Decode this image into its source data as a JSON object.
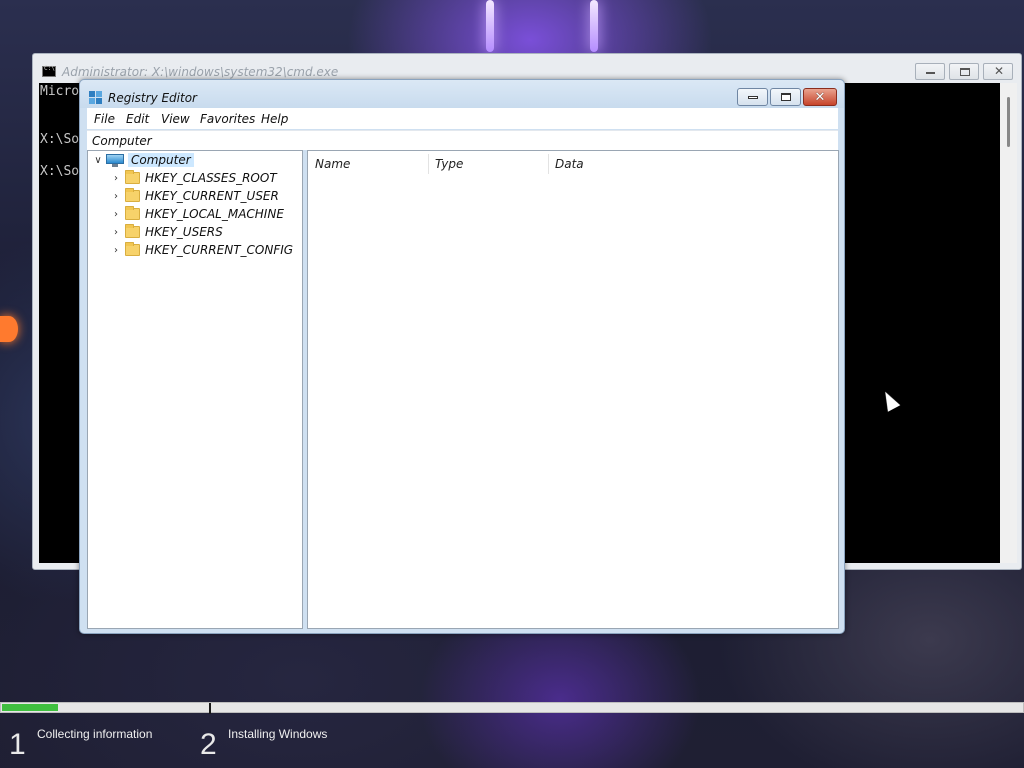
{
  "cmd": {
    "title": "Administrator: X:\\windows\\system32\\cmd.exe",
    "lines": [
      "Micro",
      "X:\\So",
      "X:\\So"
    ]
  },
  "regedit": {
    "title": "Registry Editor",
    "menu": [
      "File",
      "Edit",
      "View",
      "Favorites",
      "Help"
    ],
    "address": "Computer",
    "tree": {
      "root": "Computer",
      "children": [
        "HKEY_CLASSES_ROOT",
        "HKEY_CURRENT_USER",
        "HKEY_LOCAL_MACHINE",
        "HKEY_USERS",
        "HKEY_CURRENT_CONFIG"
      ]
    },
    "columns": [
      "Name",
      "Type",
      "Data"
    ]
  },
  "setup": {
    "progress_fraction": 0.055,
    "steps": [
      {
        "number": "1",
        "label": "Collecting information"
      },
      {
        "number": "2",
        "label": "Installing Windows"
      }
    ]
  },
  "colors": {
    "progress": "#3fbf3f",
    "close_button": "#c7442b",
    "selection": "#cde8ff"
  }
}
